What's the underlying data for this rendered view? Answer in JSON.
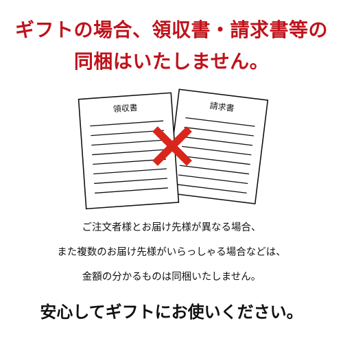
{
  "headline": {
    "line1": "ギフトの場合、領収書・請求書等の",
    "line2": "同梱はいたしません。",
    "color": "#c0121a"
  },
  "illustration": {
    "receipt_label": "領収書",
    "invoice_label": "請求書",
    "cross_icon": "cross-icon",
    "cross_color": "#d9261c"
  },
  "body": {
    "line1": "ご注文者様とお届け先様が異なる場合、",
    "line2": "また複数のお届け先様がいらっしゃる場合などは、",
    "line3": "金額の分かるものは同梱いたしません。"
  },
  "closing": {
    "text": "安心してギフトにお使いください。"
  }
}
